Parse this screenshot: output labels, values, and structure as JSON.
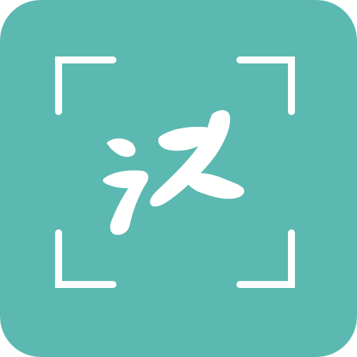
{
  "app_icon": {
    "glyph_name": "calligraphy-brush-character",
    "frame_icon": "scan-frame-corners-icon",
    "colors": {
      "background": "#5bb9b1",
      "foreground": "#ffffff"
    }
  }
}
